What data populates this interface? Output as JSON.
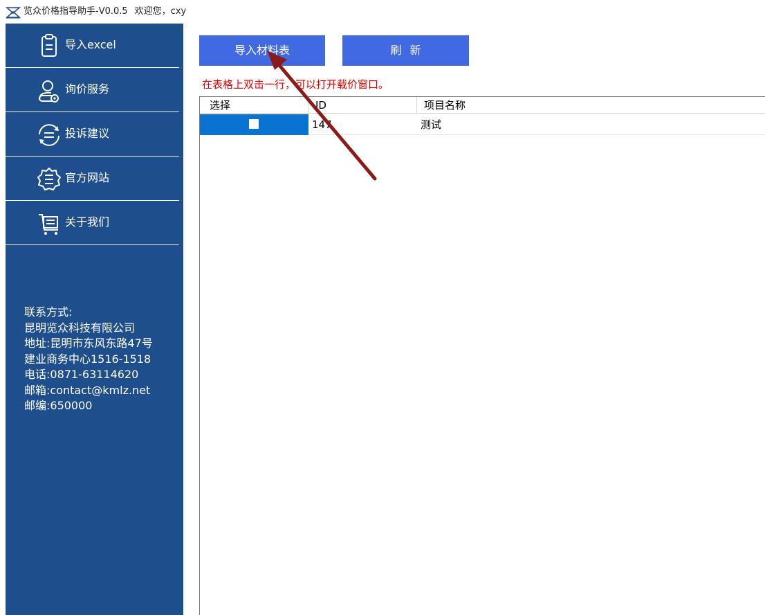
{
  "window": {
    "title": "览众价格指导助手-V0.0.5",
    "welcome": "欢迎您，cxy"
  },
  "sidebar": {
    "items": [
      {
        "label": "导入excel",
        "icon": "clipboard-list-icon"
      },
      {
        "label": "询价服务",
        "icon": "user-search-icon"
      },
      {
        "label": "投诉建议",
        "icon": "chat-refresh-icon"
      },
      {
        "label": "官方网站",
        "icon": "gear-menu-icon"
      },
      {
        "label": "关于我们",
        "icon": "cart-list-icon"
      }
    ],
    "contact": {
      "heading": "联系方式:",
      "company": "昆明览众科技有限公司",
      "address": "地址:昆明市东风东路47号",
      "address2": "建业商务中心1516-1518",
      "phone": "电话:0871-63114620",
      "email": "邮箱:contact@kmlz.net",
      "postcode": "邮编:650000"
    }
  },
  "toolbar": {
    "import_label": "导入材料表",
    "refresh_label": "刷新"
  },
  "hint_text": "在表格上双击一行，可以打开载价窗口。",
  "table": {
    "columns": [
      "选择",
      "ID",
      "项目名称"
    ],
    "rows": [
      {
        "selected": false,
        "id": "147",
        "name": "测试"
      }
    ]
  },
  "colors": {
    "sidebar_bg": "#1f4e8c",
    "button_bg": "#4169e1",
    "selected_cell": "#0a72d1",
    "hint_text": "#e60000",
    "annotation_arrow": "#8b1a1a"
  }
}
